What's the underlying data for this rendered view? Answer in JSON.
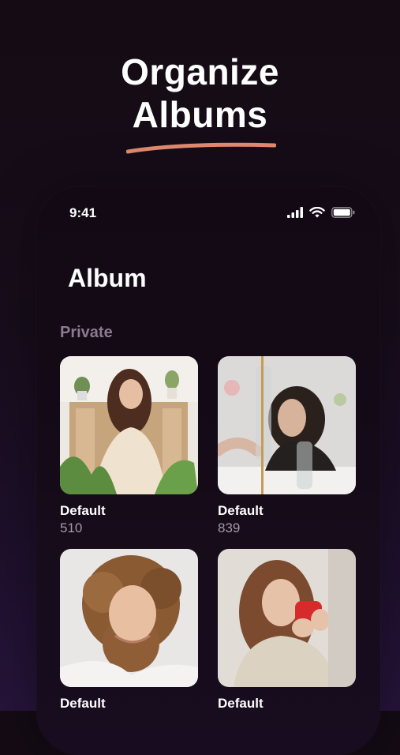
{
  "headline": {
    "line1": "Organize",
    "line2": "Albums"
  },
  "colors": {
    "accent_underline": "#e08a6e",
    "background": "#150b18",
    "muted_text": "#8c7a8e"
  },
  "status_bar": {
    "time": "9:41",
    "icons": [
      "cellular-signal-icon",
      "wifi-icon",
      "battery-icon"
    ]
  },
  "screen": {
    "title": "Album",
    "section": "Private",
    "albums": [
      {
        "name": "Default",
        "count": "510"
      },
      {
        "name": "Default",
        "count": "839"
      },
      {
        "name": "Default",
        "count": ""
      },
      {
        "name": "Default",
        "count": ""
      }
    ]
  }
}
